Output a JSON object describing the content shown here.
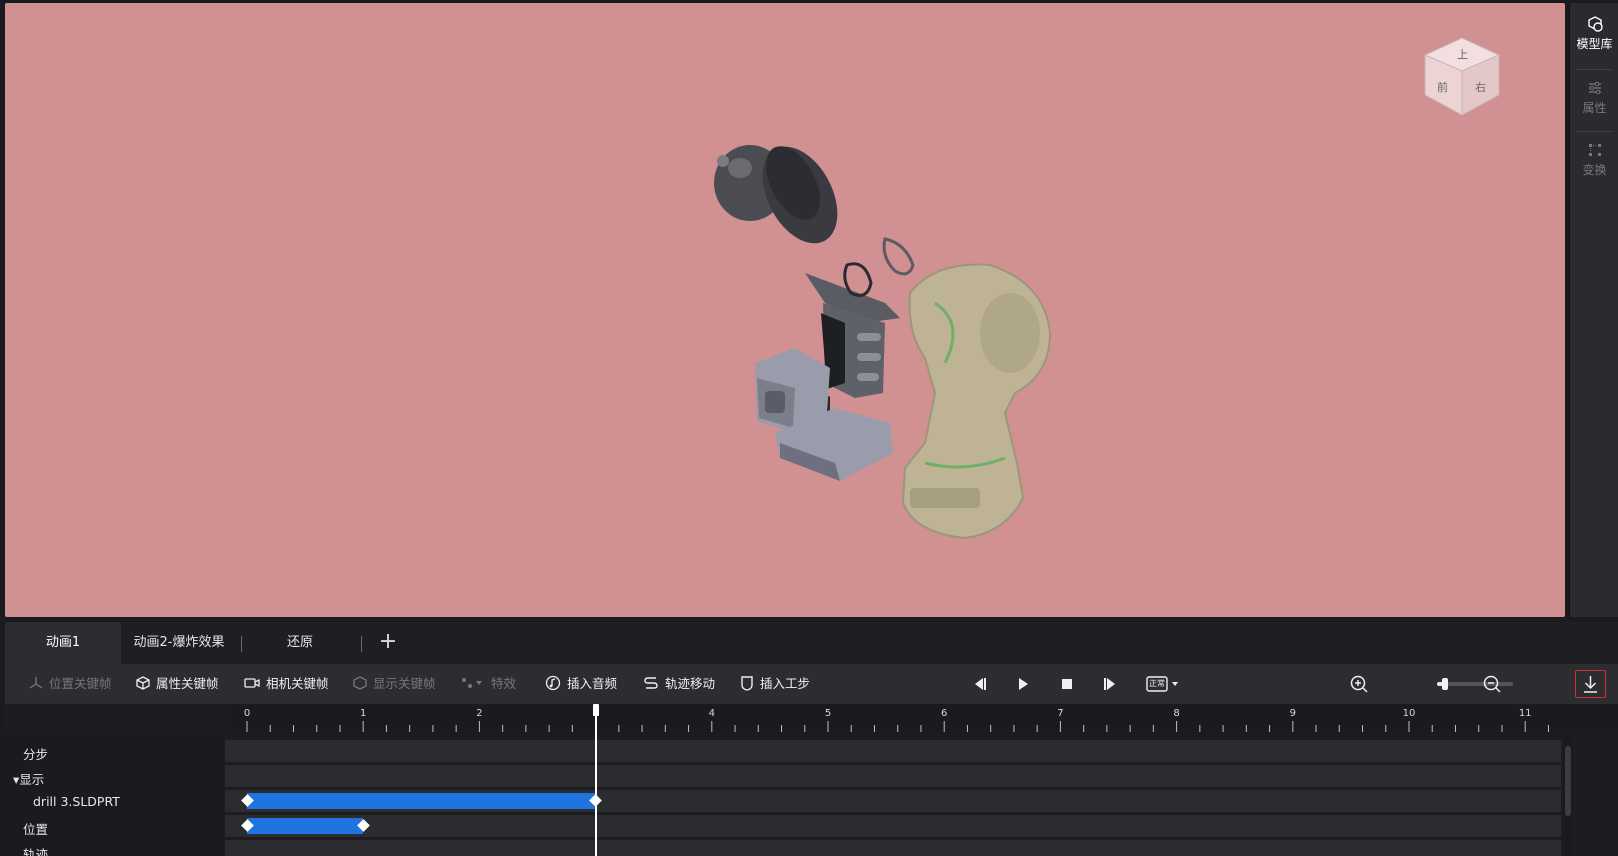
{
  "right_panel": {
    "items": [
      {
        "label": "模型库",
        "icon": "model-library-icon"
      },
      {
        "label": "属性",
        "icon": "sliders-icon"
      },
      {
        "label": "变换",
        "icon": "transform-icon"
      }
    ]
  },
  "view_cube": {
    "top": "上",
    "front": "前",
    "right": "右"
  },
  "tabs": [
    {
      "label": "动画1",
      "active": true
    },
    {
      "label": "动画2-爆炸效果",
      "active": false
    },
    {
      "label": "还原",
      "active": false
    }
  ],
  "tab_add_label": "+",
  "toolbar": {
    "position_keyframe": "位置关键帧",
    "property_keyframe": "属性关键帧",
    "camera_keyframe": "相机关键帧",
    "display_keyframe": "显示关键帧",
    "effects": "特效",
    "insert_audio": "插入音频",
    "track_move": "轨迹移动",
    "insert_step": "插入工步",
    "playback_mode": "正常",
    "zoom_level": 0.1
  },
  "timeline": {
    "ticks": [
      "0",
      "1",
      "2",
      "3",
      "4",
      "5",
      "6",
      "7",
      "8",
      "9",
      "10",
      "11"
    ],
    "playhead_time": 3,
    "tracks": [
      {
        "label": "分步",
        "indent": 0
      },
      {
        "label": "显示",
        "indent": 0,
        "expanded": true
      },
      {
        "label": "drill 3.SLDPRT",
        "indent": 1,
        "bar": [
          0,
          3
        ]
      },
      {
        "label": "位置",
        "indent": 0,
        "bar": [
          0,
          1
        ]
      },
      {
        "label": "轨迹",
        "indent": 0
      }
    ]
  },
  "colors": {
    "viewport_bg": "#d19092",
    "accent_blue": "#1f74e0",
    "export_border": "#d82c2c"
  }
}
